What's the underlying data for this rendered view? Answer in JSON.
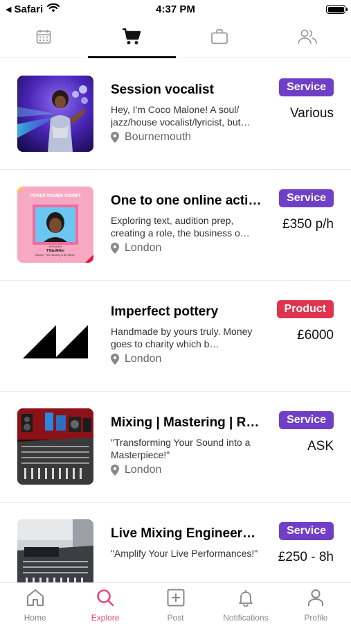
{
  "status_bar": {
    "back_app": "Safari",
    "time": "4:37 PM"
  },
  "top_tabs": [
    {
      "icon": "calendar-icon",
      "active": false
    },
    {
      "icon": "cart-icon",
      "active": true
    },
    {
      "icon": "briefcase-icon",
      "active": false
    },
    {
      "icon": "people-icon",
      "active": false
    }
  ],
  "listings": [
    {
      "title": "Session vocalist",
      "description": "Hey, I'm Coco Malone! A soul/ jazz/house vocalist/lyricist, but…",
      "location": "Bournemouth",
      "badge": "Service",
      "badge_color": "#6f3fc7",
      "price": "Various"
    },
    {
      "title": "One to one online acti…",
      "description": "Exploring text, audition prep, creating a role,  the business o…",
      "location": "London",
      "badge": "Service",
      "badge_color": "#6f3fc7",
      "price": "£350 p/h",
      "thumb_text": {
        "banner": "POWER WOMEN SUMMIT",
        "tag": "SPEAKER",
        "name": "T'Nia Miller",
        "caption": "Actress, \"The Haunting of Bly Manor\""
      }
    },
    {
      "title": "Imperfect pottery",
      "description": "Handmade by yours truly. Money goes to charity which b…",
      "location": "London",
      "badge": "Product",
      "badge_color": "#e0334e",
      "price": "£6000"
    },
    {
      "title": "Mixing | Mastering | R…",
      "description": "\"Transforming Your Sound into a Masterpiece!\"",
      "location": "London",
      "badge": "Service",
      "badge_color": "#6f3fc7",
      "price": "ASK"
    },
    {
      "title": "Live Mixing Engineer…",
      "description": "\"Amplify Your Live Performances!\"",
      "location": "",
      "badge": "Service",
      "badge_color": "#6f3fc7",
      "price": "£250 - 8h"
    }
  ],
  "bottom_nav": [
    {
      "label": "Home",
      "icon": "home-icon",
      "active": false
    },
    {
      "label": "Explore",
      "icon": "search-icon",
      "active": true
    },
    {
      "label": "Post",
      "icon": "plus-square-icon",
      "active": false
    },
    {
      "label": "Notifications",
      "icon": "bell-icon",
      "active": false
    },
    {
      "label": "Profile",
      "icon": "person-icon",
      "active": false
    }
  ],
  "colors": {
    "accent": "#e8457a",
    "service": "#6f3fc7",
    "product": "#e0334e"
  }
}
